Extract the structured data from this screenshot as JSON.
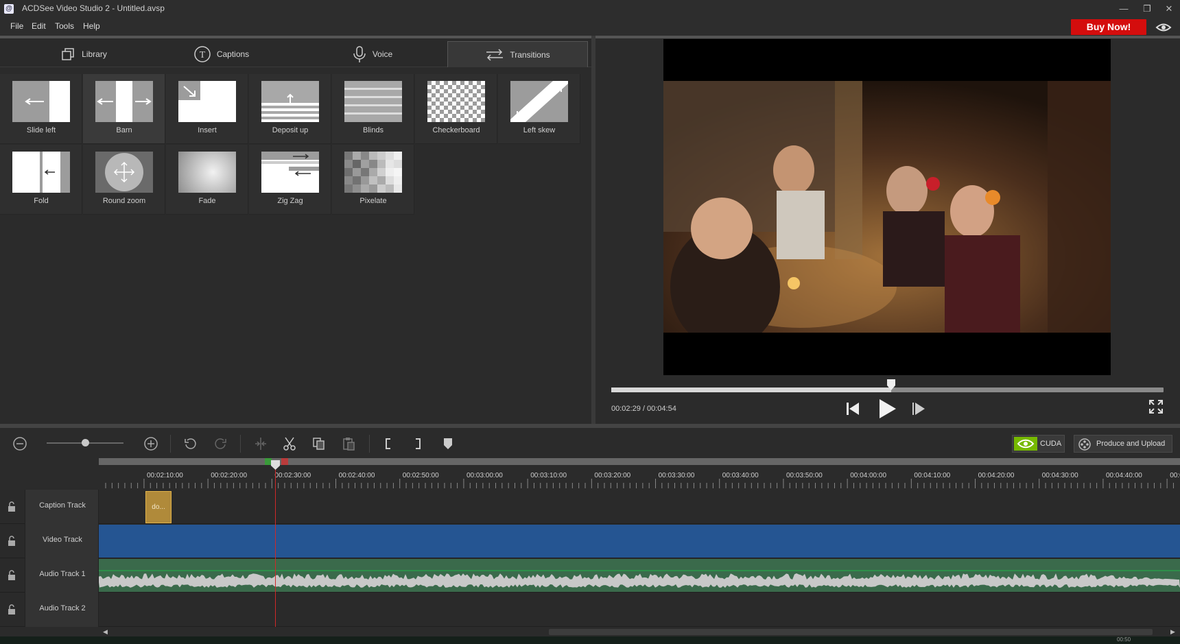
{
  "window": {
    "title": "ACDSee Video Studio 2 - Untitled.avsp"
  },
  "menu": {
    "items": [
      "File",
      "Edit",
      "Tools",
      "Help"
    ],
    "buy_label": "Buy Now!"
  },
  "tabs": [
    {
      "label": "Library",
      "icon": "library-icon",
      "active": false
    },
    {
      "label": "Captions",
      "icon": "captions-icon",
      "active": false
    },
    {
      "label": "Voice",
      "icon": "microphone-icon",
      "active": false
    },
    {
      "label": "Transitions",
      "icon": "transitions-icon",
      "active": true
    }
  ],
  "transitions": [
    {
      "label": "Slide left",
      "selected": false
    },
    {
      "label": "Barn",
      "selected": true
    },
    {
      "label": "Insert",
      "selected": false
    },
    {
      "label": "Deposit up",
      "selected": false
    },
    {
      "label": "Blinds",
      "selected": false
    },
    {
      "label": "Checkerboard",
      "selected": false
    },
    {
      "label": "Left skew",
      "selected": false
    },
    {
      "label": "Fold",
      "selected": false
    },
    {
      "label": "Round zoom",
      "selected": false
    },
    {
      "label": "Fade",
      "selected": false
    },
    {
      "label": "Zig Zag",
      "selected": false
    },
    {
      "label": "Pixelate",
      "selected": false
    }
  ],
  "player": {
    "time": "00:02:29 / 00:04:54",
    "progress": 0.507
  },
  "toolbar": {
    "cuda_label": "CUDA",
    "produce_label": "Produce and Upload"
  },
  "timeline": {
    "ruler_labels": [
      "00:02:10:00",
      "00:02:20:00",
      "00:02:30:00",
      "00:02:40:00",
      "00:02:50:00",
      "00:03:00:00",
      "00:03:10:00",
      "00:03:20:00",
      "00:03:30:00",
      "00:03:40:00",
      "00:03:50:00",
      "00:04:00:00",
      "00:04:10:00",
      "00:04:20:00",
      "00:04:30:00",
      "00:04:40:00",
      "00:0"
    ],
    "tracks": [
      "Caption Track",
      "Video Track",
      "Audio Track 1",
      "Audio Track 2"
    ],
    "caption_clip_label": "do...",
    "bottom_text": "00:50"
  },
  "colors": {
    "accent": "#d40d0d",
    "video_clip": "#255592",
    "audio_clip": "#3a6a4b",
    "caption_clip": "#b08a3a",
    "playhead": "#d02828"
  }
}
